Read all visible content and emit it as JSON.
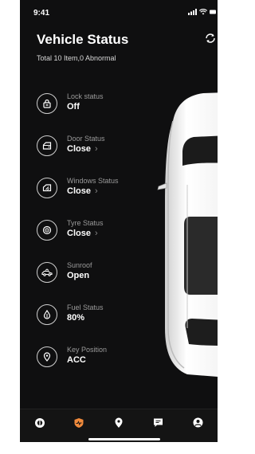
{
  "status_bar": {
    "time": "9:41"
  },
  "header": {
    "title": "Vehicle Status",
    "subtitle": "Total 10 Item,0 Abnormal"
  },
  "items": [
    {
      "label": "Lock status",
      "value": "Off",
      "icon": "lock-icon",
      "chevron": false
    },
    {
      "label": "Door Status",
      "value": "Close",
      "icon": "door-icon",
      "chevron": true
    },
    {
      "label": "Windows Status",
      "value": "Close",
      "icon": "window-icon",
      "chevron": true
    },
    {
      "label": "Tyre Status",
      "value": "Close",
      "icon": "tyre-icon",
      "chevron": true
    },
    {
      "label": "Sunroof",
      "value": "Open",
      "icon": "car-sunroof-icon",
      "chevron": false
    },
    {
      "label": "Fuel Status",
      "value": "80%",
      "icon": "fuel-drop-icon",
      "chevron": false
    },
    {
      "label": "Key Position",
      "value": "ACC",
      "icon": "location-pin-icon",
      "chevron": false
    }
  ],
  "chevron_glyph": "›",
  "tabbar": {
    "tabs": [
      {
        "icon": "steering-wheel-icon",
        "active": false
      },
      {
        "icon": "vehicle-health-icon",
        "active": true
      },
      {
        "icon": "map-pin-icon",
        "active": false
      },
      {
        "icon": "message-icon",
        "active": false
      },
      {
        "icon": "profile-icon",
        "active": false
      }
    ]
  },
  "colors": {
    "background": "#0f0f10",
    "accent": "#f08a3c",
    "muted_text": "#9a9a9a"
  }
}
